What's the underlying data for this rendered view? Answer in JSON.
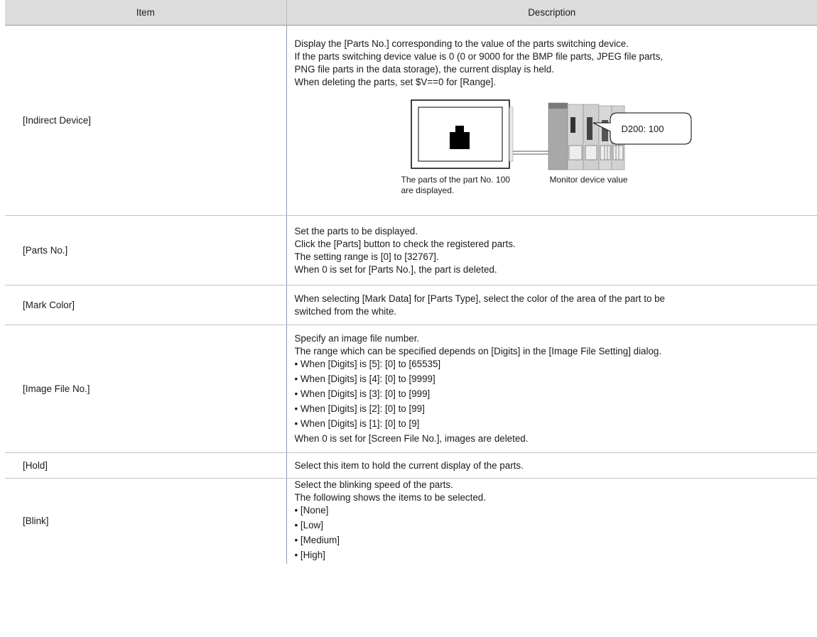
{
  "header": {
    "item": "Item",
    "description": "Description"
  },
  "rows": [
    {
      "item": "[Indirect Device]",
      "lines": [
        "Display the [Parts No.] corresponding to the value of the parts switching device.",
        "If the parts switching device value is 0 (0 or 9000 for the BMP file parts, JPEG file parts,",
        "PNG file parts in the data storage), the current display is held.",
        "When deleting the parts, set $V==0 for [Range]."
      ],
      "figure": {
        "callout": "D200: 100",
        "caption_left_1": "The parts of the part No. 100",
        "caption_left_2": "are displayed.",
        "caption_right": "Monitor device value"
      }
    },
    {
      "item": "[Parts No.]",
      "lines": [
        "Set the parts to be displayed.",
        "Click the [Parts] button to check the registered parts.",
        "The setting range is [0] to [32767].",
        "When 0 is set for [Parts No.], the part is deleted."
      ]
    },
    {
      "item": "[Mark Color]",
      "lines": [
        "When selecting [Mark Data] for [Parts Type], select the color of the area of the part to be",
        "switched from the white."
      ]
    },
    {
      "item": "[Image File No.]",
      "lines": [
        "Specify an image file number.",
        "The range which can be specified depends on [Digits] in the [Image File Setting] dialog."
      ],
      "bullets": [
        "• When [Digits] is [5]: [0] to [65535]",
        "• When [Digits] is [4]: [0] to [9999]",
        "• When [Digits] is [3]: [0] to [999]",
        "• When [Digits] is [2]: [0] to [99]",
        "• When [Digits] is [1]: [0] to [9]"
      ],
      "tail": "When 0 is set for [Screen File No.], images are deleted."
    },
    {
      "item": "[Hold]",
      "lines": [
        "Select this item to hold the current display of the parts."
      ]
    },
    {
      "item": "[Blink]",
      "lines": [
        "Select the blinking speed of the parts.",
        "The following shows the items to be selected."
      ],
      "bullets": [
        "• [None]",
        "• [Low]",
        "• [Medium]",
        "• [High]"
      ]
    }
  ]
}
